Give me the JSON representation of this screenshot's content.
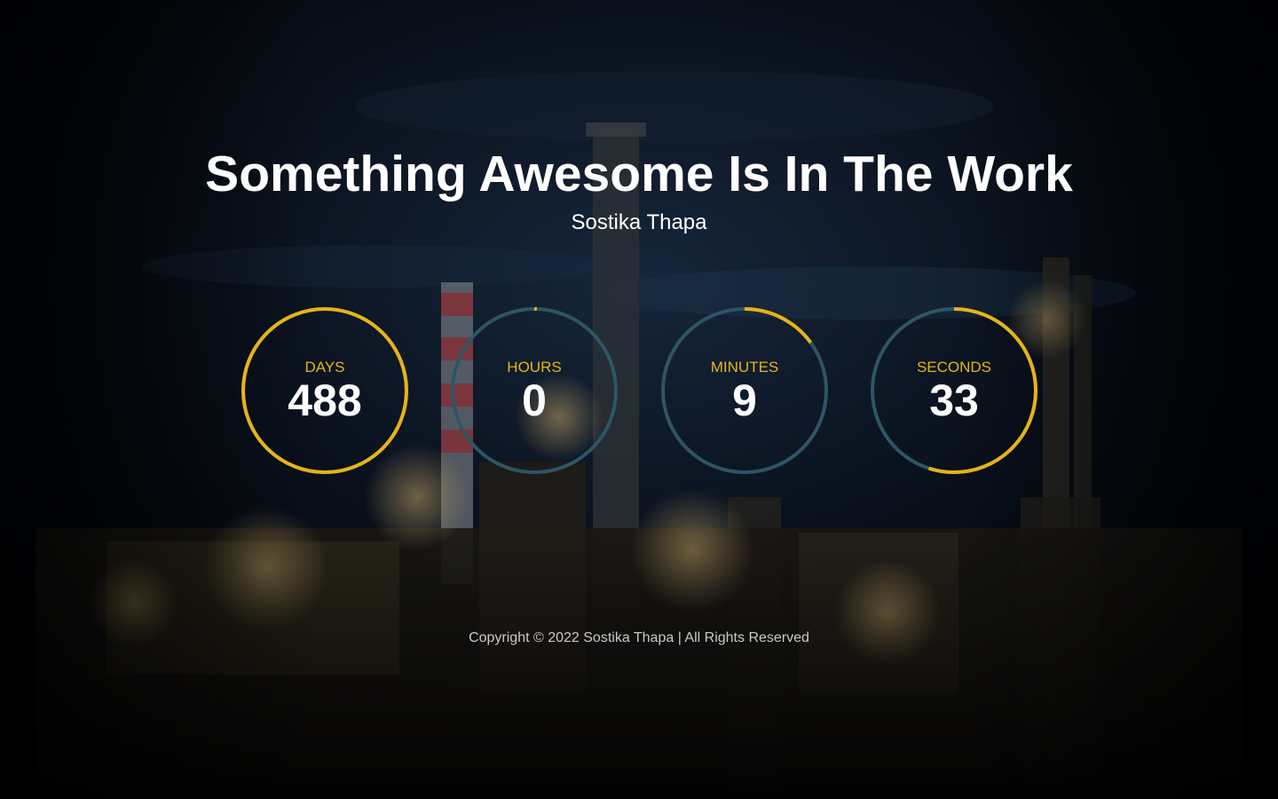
{
  "page": {
    "title": "Something Awesome Is In The Work",
    "subtitle": "Sostika Thapa",
    "footer": "Copyright © 2022 Sostika Thapa | All Rights Reserved"
  },
  "countdown": [
    {
      "label": "DAYS",
      "value": "488",
      "progress": 1.0
    },
    {
      "label": "HOURS",
      "value": "0",
      "progress": 0.005
    },
    {
      "label": "MINUTES",
      "value": "9",
      "progress": 0.15
    },
    {
      "label": "SECONDS",
      "value": "33",
      "progress": 0.55
    }
  ],
  "colors": {
    "accent": "#e6b416",
    "ring_track": "#2e5565",
    "text": "#ffffff",
    "footer_text": "#c9c9c9"
  }
}
